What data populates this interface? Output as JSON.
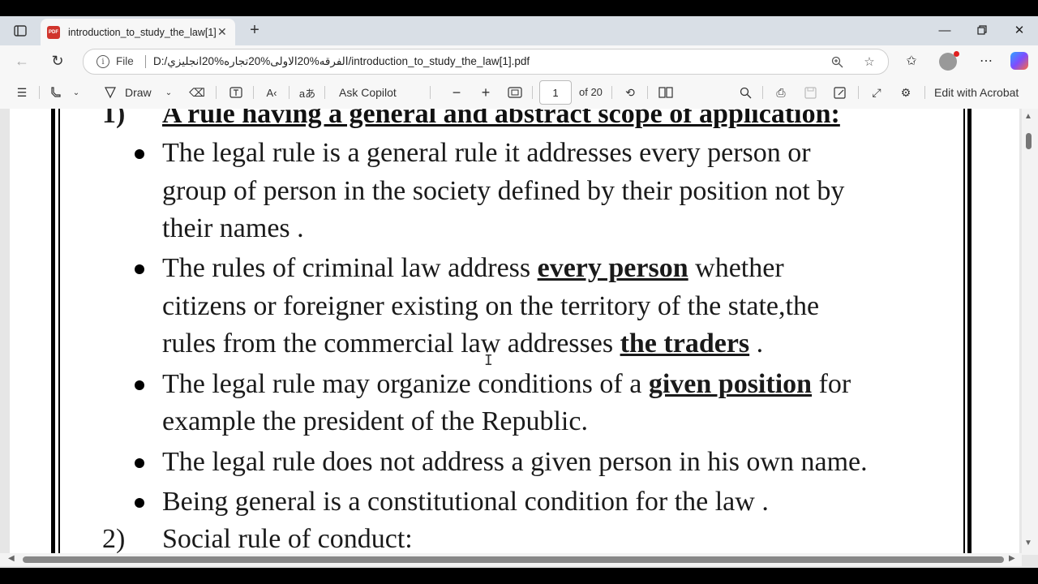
{
  "tab": {
    "title": "introduction_to_study_the_law[1].pdf",
    "badge": "PDF"
  },
  "address": {
    "file_label": "File",
    "url": "D:/الفرقه%20الاولى%20تجاره%20انجليزي/introduction_to_study_the_law[1].pdf"
  },
  "pdf_toolbar": {
    "draw_label": "Draw",
    "ask_copilot_label": "Ask Copilot",
    "page_current": "1",
    "page_total": "of 20",
    "edit_acrobat_label": "Edit with Acrobat"
  },
  "document": {
    "heading_number": "1)",
    "heading": "A rule having a general and abstract scope of application:",
    "bullet1": {
      "line1": "The legal rule is a general rule it addresses every person or",
      "line2": "group of person in the society defined by their position not by",
      "line3": "their names ."
    },
    "bullet2": {
      "line1_a": "The rules of criminal law address ",
      "line1_em": "every person",
      "line1_b": " whether",
      "line2": "citizens or foreigner existing on the territory of the state,the",
      "line3_a": "rules from the commercial law addresses ",
      "line3_em": "the traders",
      "line3_b": " ."
    },
    "bullet3": {
      "line1_a": "The legal rule may organize  conditions of a ",
      "line1_em": "given position",
      "line1_b": " for",
      "line2": "example the president of the Republic."
    },
    "bullet4": "The legal rule does not address a given person in his own name.",
    "bullet5": "Being general is a constitutional condition for the law .",
    "section2_number": "2)",
    "section2": "Social rule of conduct:"
  },
  "colors": {
    "tabstrip": "#d9dfe6",
    "toolbar": "#f7f7f7",
    "viewer_bg": "#e6e6e6",
    "pdf_red": "#d0342c"
  },
  "icons": [
    "tab-list-icon",
    "pdf-file-icon",
    "close-icon",
    "plus-icon",
    "minimize-icon",
    "restore-icon",
    "back-arrow-icon",
    "refresh-icon",
    "info-icon",
    "zoom-icon",
    "star-icon",
    "favorites-icon",
    "profile-icon",
    "more-icon",
    "copilot-icon",
    "contents-icon",
    "highlight-icon",
    "draw-icon",
    "eraser-icon",
    "text-box-icon",
    "read-aloud-icon",
    "translate-icon",
    "zoom-out-icon",
    "zoom-in-icon",
    "fit-page-icon",
    "rotate-icon",
    "two-page-icon",
    "search-icon",
    "print-icon",
    "save-icon",
    "save-as-icon",
    "fullscreen-icon",
    "settings-icon"
  ]
}
